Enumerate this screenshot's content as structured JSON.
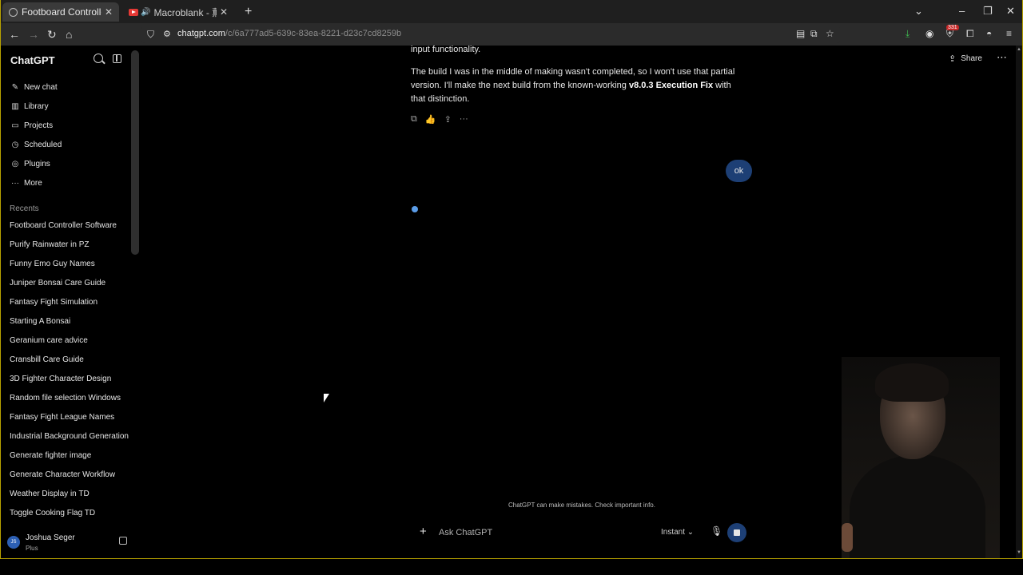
{
  "browser": {
    "tabs": [
      {
        "title": "Footboard Controller Software",
        "active": true
      },
      {
        "title": "Macroblank - 薫陶神 COLLI",
        "active": false
      }
    ],
    "url_host": "chatgpt.com",
    "url_path": "/c/6a777ad5-639c-83ea-8221-d23c7cd8259b",
    "notification_badge": "331"
  },
  "sidebar": {
    "title": "ChatGPT",
    "nav": [
      {
        "label": "New chat",
        "icon": "new-chat-icon"
      },
      {
        "label": "Library",
        "icon": "library-icon"
      },
      {
        "label": "Projects",
        "icon": "folder-icon"
      },
      {
        "label": "Scheduled",
        "icon": "clock-icon"
      },
      {
        "label": "Plugins",
        "icon": "plugins-icon"
      },
      {
        "label": "More",
        "icon": "more-icon"
      }
    ],
    "recents_label": "Recents",
    "recents": [
      "Footboard Controller Software",
      "Purify Rainwater in PZ",
      "Funny Emo Guy Names",
      "Juniper Bonsai Care Guide",
      "Fantasy Fight Simulation",
      "Starting A Bonsai",
      "Geranium care advice",
      "Cransbill Care Guide",
      "3D Fighter Character Design",
      "Random file selection Windows",
      "Fantasy Fight League Names",
      "Industrial Background Generation",
      "Generate fighter image",
      "Generate Character Workflow",
      "Weather Display in TD",
      "Toggle Cooking Flag TD"
    ],
    "user": {
      "name": "Joshua Seger",
      "plan": "Plus",
      "initials": "JS"
    }
  },
  "header": {
    "share_label": "Share"
  },
  "conversation": {
    "assistant_fragment": "input functionality.",
    "assistant_para_prefix": "The build I was in the middle of making wasn't completed, so I won't use that partial version. I'll make the next build from the known-working ",
    "assistant_para_bold": "v8.0.3 Execution Fix",
    "assistant_para_suffix": " with that distinction.",
    "user_message": "ok"
  },
  "composer": {
    "placeholder": "Ask ChatGPT",
    "mode": "Instant",
    "disclaimer": "ChatGPT can make mistakes. Check important info."
  },
  "colors": {
    "accent_blue": "#1d3f75",
    "thinking_dot": "#5b9de8",
    "frame_border": "#b8a200"
  }
}
